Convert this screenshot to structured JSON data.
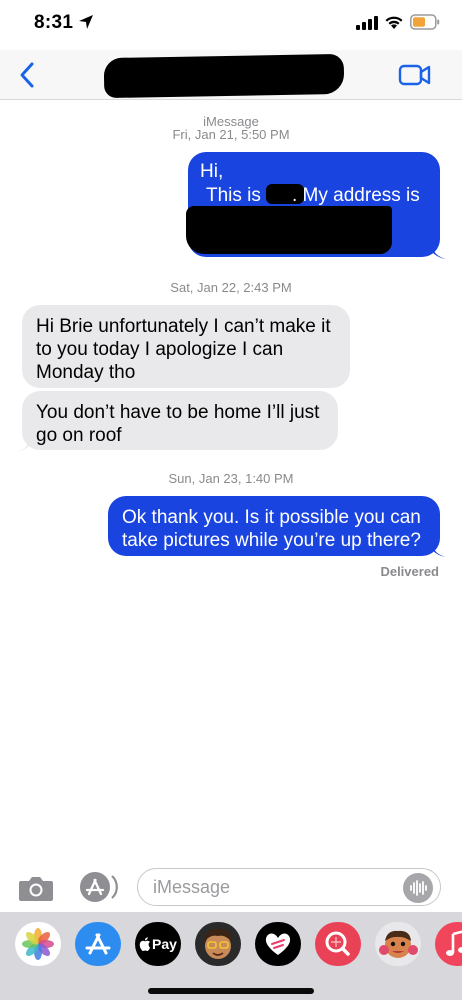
{
  "status_bar": {
    "time": "8:31"
  },
  "header": {
    "back_icon": "chevron-left-icon",
    "video_icon": "video-camera-icon"
  },
  "conversation": {
    "service_label": "iMessage",
    "messages_header_time": "Fri, Jan 21, 5:50 PM",
    "first_message": {
      "line1": "Hi,",
      "line2_start": "This is",
      "line2_end": ". My address is"
    },
    "second_timestamp": "Sat, Jan 22, 2:43 PM",
    "incoming_1": "Hi Brie unfortunately I can’t make it to you today I apologize I can Monday tho",
    "incoming_2": "You don’t have to be home I’ll just go on roof",
    "third_timestamp": "Sun, Jan 23, 1:40 PM",
    "outgoing_2": "Ok thank you. Is it possible you can take pictures while you’re up there?",
    "delivered_label": "Delivered"
  },
  "compose": {
    "placeholder": "iMessage",
    "value": ""
  },
  "app_drawer": {
    "apple_pay_label": "Pay",
    "apps": [
      "photos-icon",
      "app-store-icon",
      "apple-pay-icon",
      "memoji-icon",
      "digital-touch-icon",
      "search-images-icon",
      "animoji-icon",
      "music-icon"
    ]
  },
  "colors": {
    "outgoing_bubble": "#1a44e0",
    "incoming_bubble": "#e9e9eb",
    "accent": "#1a63e8"
  }
}
